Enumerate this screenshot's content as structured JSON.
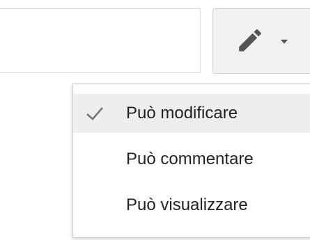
{
  "menu": {
    "items": [
      {
        "label": "Può modificare",
        "checked": true
      },
      {
        "label": "Può commentare",
        "checked": false
      },
      {
        "label": "Può visualizzare",
        "checked": false
      }
    ]
  },
  "icons": {
    "permission_button": "pencil-icon",
    "dropdown": "chevron-down-icon",
    "selected_marker": "check-icon"
  },
  "colors": {
    "menu_hover_bg": "#eeeeee",
    "button_bg": "#f1f1f1",
    "icon": "#555555"
  }
}
